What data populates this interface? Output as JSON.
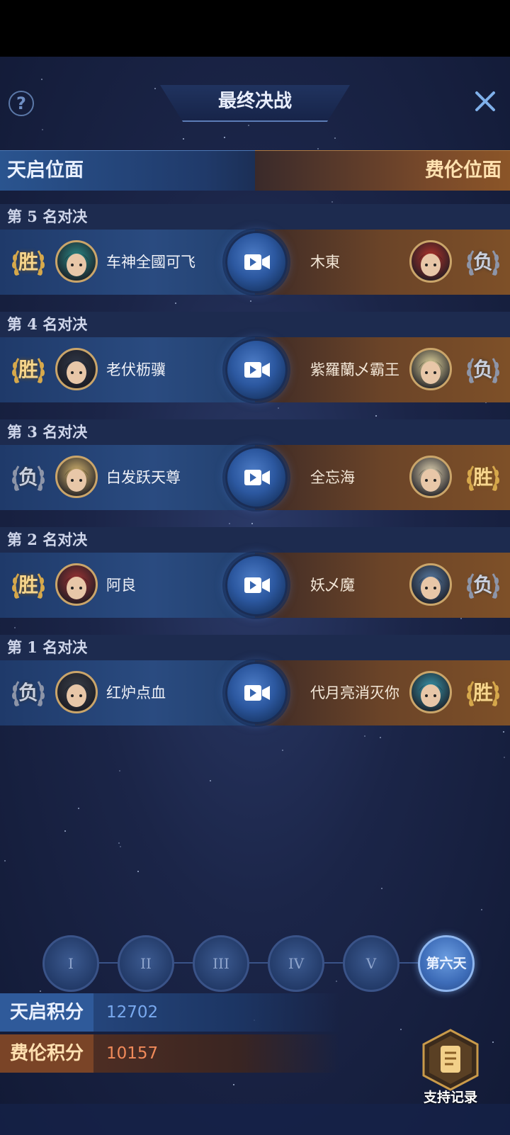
{
  "header": {
    "title": "最终决战",
    "help_icon": "?"
  },
  "factions": {
    "left": "天启位面",
    "right": "费伦位面"
  },
  "matches": [
    {
      "title": "第 5 名对决",
      "left": {
        "result": "胜",
        "name": "车神全國可飞"
      },
      "right": {
        "result": "负",
        "name": "木東"
      }
    },
    {
      "title": "第 4 名对决",
      "left": {
        "result": "胜",
        "name": "老伏枥骥"
      },
      "right": {
        "result": "负",
        "name": "紫羅蘭乄霸王"
      }
    },
    {
      "title": "第 3 名对决",
      "left": {
        "result": "负",
        "name": "白发跃天尊"
      },
      "right": {
        "result": "胜",
        "name": "全忘海"
      }
    },
    {
      "title": "第 2 名对决",
      "left": {
        "result": "胜",
        "name": "阿良"
      },
      "right": {
        "result": "负",
        "name": "妖乄魔"
      }
    },
    {
      "title": "第 1 名对决",
      "left": {
        "result": "负",
        "name": "红炉点血"
      },
      "right": {
        "result": "胜",
        "name": "代月亮消灭你"
      }
    }
  ],
  "rounds": [
    "I",
    "II",
    "III",
    "IV",
    "V",
    "第六天"
  ],
  "active_round": "第六天",
  "scores": {
    "tianqi": {
      "label": "天启积分",
      "value": "12702"
    },
    "feilun": {
      "label": "费伦积分",
      "value": "10157"
    }
  },
  "support_button": {
    "label": "支持记录"
  },
  "colors": {
    "win": "#f6d58c",
    "lose": "#c9cfdd",
    "accent_blue": "#2f5a9a",
    "accent_orange": "#7a4427"
  }
}
